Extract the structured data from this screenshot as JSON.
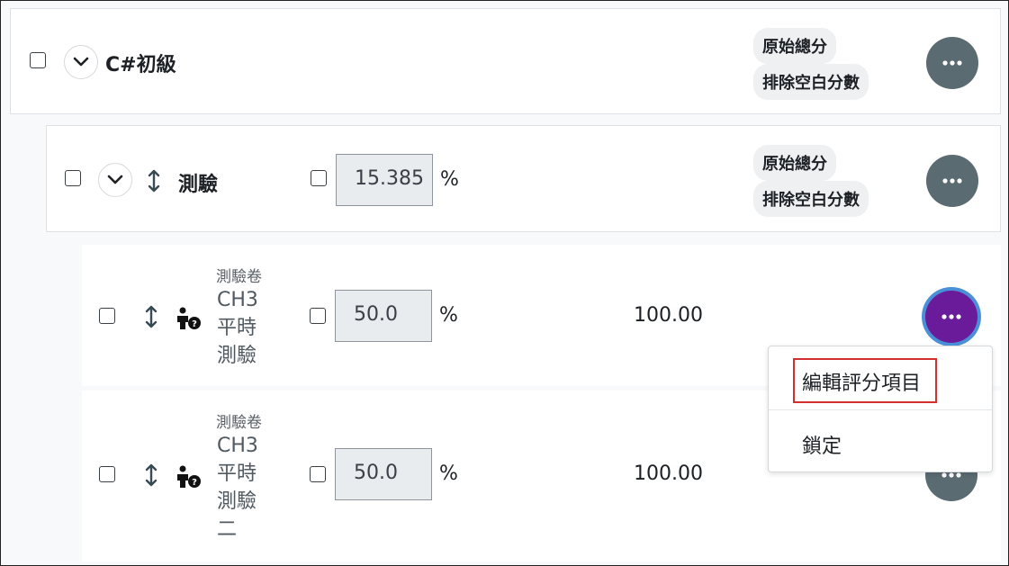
{
  "category": {
    "title": "C#初級",
    "badges": [
      "原始總分",
      "排除空白分數"
    ]
  },
  "subcategory": {
    "title": "測驗",
    "weight_value": "15.385",
    "percent_sign": "%",
    "badges": [
      "原始總分",
      "排除空白分數"
    ]
  },
  "items": [
    {
      "type": "測驗卷",
      "name_lines": [
        "CH3",
        "平時",
        "測驗"
      ],
      "weight_value": "50.0",
      "percent_sign": "%",
      "max_grade": "100.00"
    },
    {
      "type": "測驗卷",
      "name_lines": [
        "CH3",
        "平時",
        "測驗",
        "二"
      ],
      "weight_value": "50.0",
      "percent_sign": "%",
      "max_grade": "100.00"
    }
  ],
  "action_menu": {
    "items": [
      "編輯評分項目",
      "鎖定"
    ],
    "highlighted_item": "編輯評分項目",
    "highlight_color": "#d32f2f"
  },
  "colors": {
    "more_button": "#5b6b72",
    "more_button_active": "#6a1b9a",
    "focus_ring": "#4a90d9"
  },
  "icons": [
    "chevron-down-icon",
    "sort-arrows-icon",
    "user-question-icon",
    "more-dots-icon"
  ]
}
